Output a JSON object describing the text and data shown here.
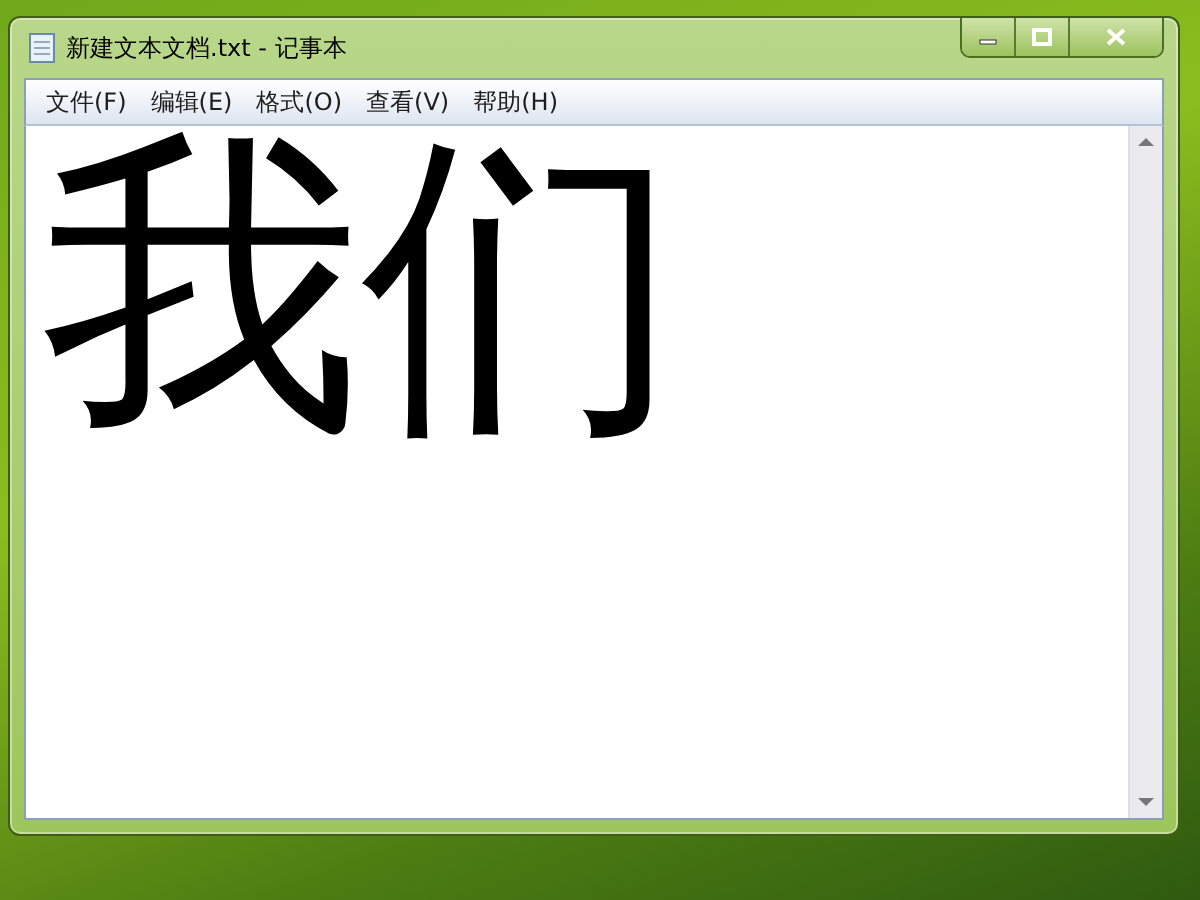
{
  "window": {
    "title": "新建文本文档.txt - 记事本"
  },
  "menu": [
    {
      "label": "文件(F)"
    },
    {
      "label": "编辑(E)"
    },
    {
      "label": "格式(O)"
    },
    {
      "label": "查看(V)"
    },
    {
      "label": "帮助(H)"
    }
  ],
  "document": {
    "text": "我们"
  }
}
